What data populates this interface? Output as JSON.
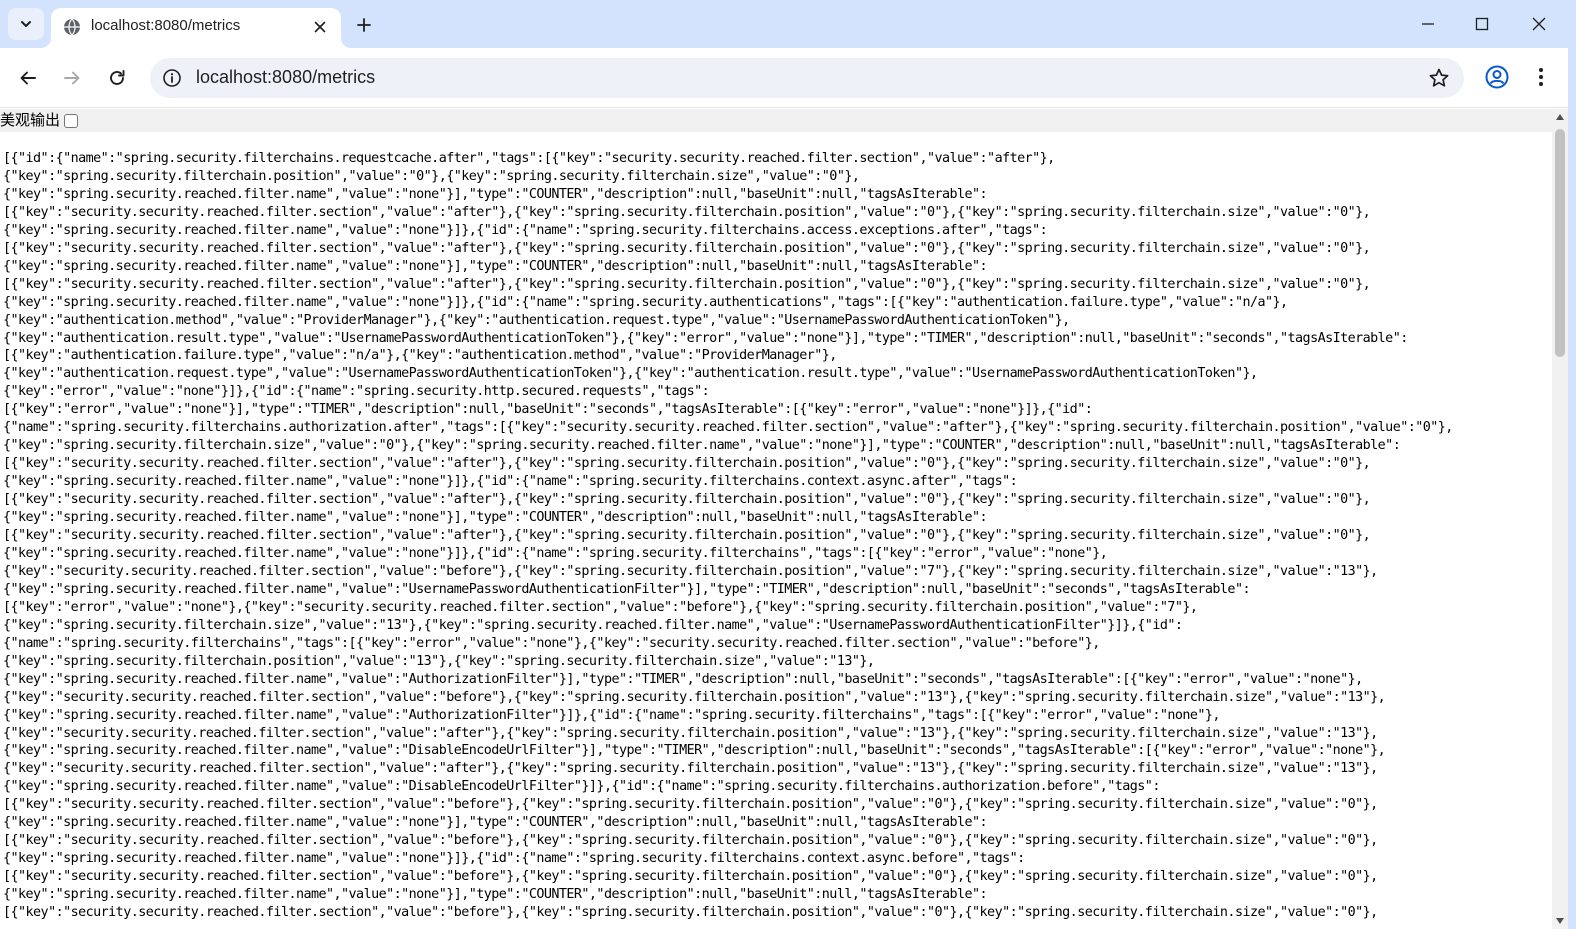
{
  "browser": {
    "tab": {
      "title": "localhost:8080/metrics"
    },
    "address_bar": {
      "url": "localhost:8080/metrics"
    },
    "icons": {
      "tab_search": "chevron-down-icon",
      "favicon": "globe-icon",
      "tab_close": "close-icon",
      "new_tab": "plus-icon",
      "minimize": "minimize-icon",
      "maximize": "maximize-icon",
      "window_close": "close-icon",
      "back": "arrow-left-icon",
      "forward": "arrow-right-icon",
      "reload": "reload-icon",
      "site_info": "info-icon",
      "bookmark": "star-icon",
      "profile": "profile-icon",
      "menu": "kebab-menu-icon"
    },
    "colors": {
      "tabstrip": "#d3e3fd",
      "omnibox": "#eef2f8",
      "pretty_bar": "#f0f0f0"
    }
  },
  "page": {
    "pretty_print_label": "美观输出",
    "pretty_print_checked": false,
    "json_lines": [
      "[{\"id\":{\"name\":\"spring.security.filterchains.requestcache.after\",\"tags\":[{\"key\":\"security.security.reached.filter.section\",\"value\":\"after\"},",
      "{\"key\":\"spring.security.filterchain.position\",\"value\":\"0\"},{\"key\":\"spring.security.filterchain.size\",\"value\":\"0\"},",
      "{\"key\":\"spring.security.reached.filter.name\",\"value\":\"none\"}],\"type\":\"COUNTER\",\"description\":null,\"baseUnit\":null,\"tagsAsIterable\":",
      "[{\"key\":\"security.security.reached.filter.section\",\"value\":\"after\"},{\"key\":\"spring.security.filterchain.position\",\"value\":\"0\"},{\"key\":\"spring.security.filterchain.size\",\"value\":\"0\"},",
      "{\"key\":\"spring.security.reached.filter.name\",\"value\":\"none\"}]},{\"id\":{\"name\":\"spring.security.filterchains.access.exceptions.after\",\"tags\":",
      "[{\"key\":\"security.security.reached.filter.section\",\"value\":\"after\"},{\"key\":\"spring.security.filterchain.position\",\"value\":\"0\"},{\"key\":\"spring.security.filterchain.size\",\"value\":\"0\"},",
      "{\"key\":\"spring.security.reached.filter.name\",\"value\":\"none\"}],\"type\":\"COUNTER\",\"description\":null,\"baseUnit\":null,\"tagsAsIterable\":",
      "[{\"key\":\"security.security.reached.filter.section\",\"value\":\"after\"},{\"key\":\"spring.security.filterchain.position\",\"value\":\"0\"},{\"key\":\"spring.security.filterchain.size\",\"value\":\"0\"},",
      "{\"key\":\"spring.security.reached.filter.name\",\"value\":\"none\"}]},{\"id\":{\"name\":\"spring.security.authentications\",\"tags\":[{\"key\":\"authentication.failure.type\",\"value\":\"n/a\"},",
      "{\"key\":\"authentication.method\",\"value\":\"ProviderManager\"},{\"key\":\"authentication.request.type\",\"value\":\"UsernamePasswordAuthenticationToken\"},",
      "{\"key\":\"authentication.result.type\",\"value\":\"UsernamePasswordAuthenticationToken\"},{\"key\":\"error\",\"value\":\"none\"}],\"type\":\"TIMER\",\"description\":null,\"baseUnit\":\"seconds\",\"tagsAsIterable\":",
      "[{\"key\":\"authentication.failure.type\",\"value\":\"n/a\"},{\"key\":\"authentication.method\",\"value\":\"ProviderManager\"},",
      "{\"key\":\"authentication.request.type\",\"value\":\"UsernamePasswordAuthenticationToken\"},{\"key\":\"authentication.result.type\",\"value\":\"UsernamePasswordAuthenticationToken\"},",
      "{\"key\":\"error\",\"value\":\"none\"}]},{\"id\":{\"name\":\"spring.security.http.secured.requests\",\"tags\":",
      "[{\"key\":\"error\",\"value\":\"none\"}],\"type\":\"TIMER\",\"description\":null,\"baseUnit\":\"seconds\",\"tagsAsIterable\":[{\"key\":\"error\",\"value\":\"none\"}]},{\"id\":",
      "{\"name\":\"spring.security.filterchains.authorization.after\",\"tags\":[{\"key\":\"security.security.reached.filter.section\",\"value\":\"after\"},{\"key\":\"spring.security.filterchain.position\",\"value\":\"0\"},",
      "{\"key\":\"spring.security.filterchain.size\",\"value\":\"0\"},{\"key\":\"spring.security.reached.filter.name\",\"value\":\"none\"}],\"type\":\"COUNTER\",\"description\":null,\"baseUnit\":null,\"tagsAsIterable\":",
      "[{\"key\":\"security.security.reached.filter.section\",\"value\":\"after\"},{\"key\":\"spring.security.filterchain.position\",\"value\":\"0\"},{\"key\":\"spring.security.filterchain.size\",\"value\":\"0\"},",
      "{\"key\":\"spring.security.reached.filter.name\",\"value\":\"none\"}]},{\"id\":{\"name\":\"spring.security.filterchains.context.async.after\",\"tags\":",
      "[{\"key\":\"security.security.reached.filter.section\",\"value\":\"after\"},{\"key\":\"spring.security.filterchain.position\",\"value\":\"0\"},{\"key\":\"spring.security.filterchain.size\",\"value\":\"0\"},",
      "{\"key\":\"spring.security.reached.filter.name\",\"value\":\"none\"}],\"type\":\"COUNTER\",\"description\":null,\"baseUnit\":null,\"tagsAsIterable\":",
      "[{\"key\":\"security.security.reached.filter.section\",\"value\":\"after\"},{\"key\":\"spring.security.filterchain.position\",\"value\":\"0\"},{\"key\":\"spring.security.filterchain.size\",\"value\":\"0\"},",
      "{\"key\":\"spring.security.reached.filter.name\",\"value\":\"none\"}]},{\"id\":{\"name\":\"spring.security.filterchains\",\"tags\":[{\"key\":\"error\",\"value\":\"none\"},",
      "{\"key\":\"security.security.reached.filter.section\",\"value\":\"before\"},{\"key\":\"spring.security.filterchain.position\",\"value\":\"7\"},{\"key\":\"spring.security.filterchain.size\",\"value\":\"13\"},",
      "{\"key\":\"spring.security.reached.filter.name\",\"value\":\"UsernamePasswordAuthenticationFilter\"}],\"type\":\"TIMER\",\"description\":null,\"baseUnit\":\"seconds\",\"tagsAsIterable\":",
      "[{\"key\":\"error\",\"value\":\"none\"},{\"key\":\"security.security.reached.filter.section\",\"value\":\"before\"},{\"key\":\"spring.security.filterchain.position\",\"value\":\"7\"},",
      "{\"key\":\"spring.security.filterchain.size\",\"value\":\"13\"},{\"key\":\"spring.security.reached.filter.name\",\"value\":\"UsernamePasswordAuthenticationFilter\"}]},{\"id\":",
      "{\"name\":\"spring.security.filterchains\",\"tags\":[{\"key\":\"error\",\"value\":\"none\"},{\"key\":\"security.security.reached.filter.section\",\"value\":\"before\"},",
      "{\"key\":\"spring.security.filterchain.position\",\"value\":\"13\"},{\"key\":\"spring.security.filterchain.size\",\"value\":\"13\"},",
      "{\"key\":\"spring.security.reached.filter.name\",\"value\":\"AuthorizationFilter\"}],\"type\":\"TIMER\",\"description\":null,\"baseUnit\":\"seconds\",\"tagsAsIterable\":[{\"key\":\"error\",\"value\":\"none\"},",
      "{\"key\":\"security.security.reached.filter.section\",\"value\":\"before\"},{\"key\":\"spring.security.filterchain.position\",\"value\":\"13\"},{\"key\":\"spring.security.filterchain.size\",\"value\":\"13\"},",
      "{\"key\":\"spring.security.reached.filter.name\",\"value\":\"AuthorizationFilter\"}]},{\"id\":{\"name\":\"spring.security.filterchains\",\"tags\":[{\"key\":\"error\",\"value\":\"none\"},",
      "{\"key\":\"security.security.reached.filter.section\",\"value\":\"after\"},{\"key\":\"spring.security.filterchain.position\",\"value\":\"13\"},{\"key\":\"spring.security.filterchain.size\",\"value\":\"13\"},",
      "{\"key\":\"spring.security.reached.filter.name\",\"value\":\"DisableEncodeUrlFilter\"}],\"type\":\"TIMER\",\"description\":null,\"baseUnit\":\"seconds\",\"tagsAsIterable\":[{\"key\":\"error\",\"value\":\"none\"},",
      "{\"key\":\"security.security.reached.filter.section\",\"value\":\"after\"},{\"key\":\"spring.security.filterchain.position\",\"value\":\"13\"},{\"key\":\"spring.security.filterchain.size\",\"value\":\"13\"},",
      "{\"key\":\"spring.security.reached.filter.name\",\"value\":\"DisableEncodeUrlFilter\"}]},{\"id\":{\"name\":\"spring.security.filterchains.authorization.before\",\"tags\":",
      "[{\"key\":\"security.security.reached.filter.section\",\"value\":\"before\"},{\"key\":\"spring.security.filterchain.position\",\"value\":\"0\"},{\"key\":\"spring.security.filterchain.size\",\"value\":\"0\"},",
      "{\"key\":\"spring.security.reached.filter.name\",\"value\":\"none\"}],\"type\":\"COUNTER\",\"description\":null,\"baseUnit\":null,\"tagsAsIterable\":",
      "[{\"key\":\"security.security.reached.filter.section\",\"value\":\"before\"},{\"key\":\"spring.security.filterchain.position\",\"value\":\"0\"},{\"key\":\"spring.security.filterchain.size\",\"value\":\"0\"},",
      "{\"key\":\"spring.security.reached.filter.name\",\"value\":\"none\"}]},{\"id\":{\"name\":\"spring.security.filterchains.context.async.before\",\"tags\":",
      "[{\"key\":\"security.security.reached.filter.section\",\"value\":\"before\"},{\"key\":\"spring.security.filterchain.position\",\"value\":\"0\"},{\"key\":\"spring.security.filterchain.size\",\"value\":\"0\"},",
      "{\"key\":\"spring.security.reached.filter.name\",\"value\":\"none\"}],\"type\":\"COUNTER\",\"description\":null,\"baseUnit\":null,\"tagsAsIterable\":",
      "[{\"key\":\"security.security.reached.filter.section\",\"value\":\"before\"},{\"key\":\"spring.security.filterchain.position\",\"value\":\"0\"},{\"key\":\"spring.security.filterchain.size\",\"value\":\"0\"},"
    ]
  }
}
